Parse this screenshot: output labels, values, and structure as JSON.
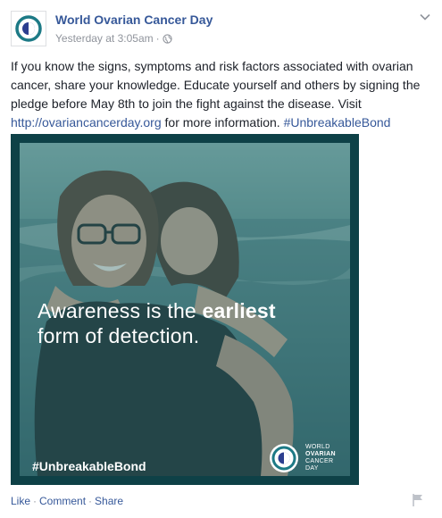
{
  "page": {
    "name": "World Ovarian Cancer Day",
    "timestamp": "Yesterday at 3:05am",
    "separator": "·",
    "privacy_icon": "globe-icon"
  },
  "post": {
    "text_before_link": "If you know the signs, symptoms and risk factors associated with ovarian cancer, share your knowledge. Educate yourself and others by signing the pledge before May 8th to join the fight against the disease. Visit ",
    "link": "http://ovariancancerday.org",
    "text_after_link": " for more information. ",
    "hashtag": "#UnbreakableBond"
  },
  "image": {
    "line1_regular": "Awareness is the ",
    "line1_bold": "earliest",
    "line2": "form of detection.",
    "hashtag": "#UnbreakableBond",
    "logo_line1": "WORLD",
    "logo_line2": "OVARIAN",
    "logo_line3": "CANCER",
    "logo_line4": "DAY"
  },
  "actions": {
    "like": "Like",
    "comment": "Comment",
    "share": "Share",
    "separator": "·"
  },
  "colors": {
    "link": "#365899",
    "image_frame": "#0e4147",
    "logo_teal": "#1d7a86"
  }
}
